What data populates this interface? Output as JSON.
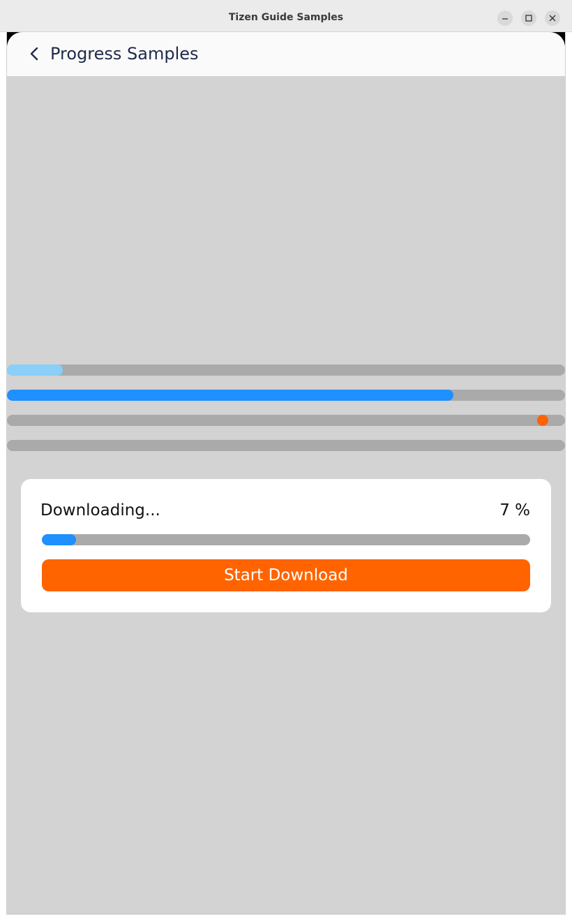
{
  "window": {
    "title": "Tizen Guide Samples",
    "controls": {
      "minimize_icon": "minimize-icon",
      "maximize_icon": "maximize-icon",
      "close_icon": "close-icon"
    }
  },
  "appbar": {
    "back_icon": "chevron-left-icon",
    "title": "Progress Samples"
  },
  "progress_bars": [
    {
      "style": "buffer",
      "value": 0.1,
      "color": "#89cff7"
    },
    {
      "style": "determinate",
      "value": 0.8,
      "color": "#1e90ff"
    },
    {
      "style": "indeterminate",
      "indicator_position": 0.96,
      "color": "#ff6200"
    },
    {
      "style": "empty",
      "value": 0.0
    }
  ],
  "download_card": {
    "label": "Downloading...",
    "percent_text": "7 %",
    "progress": 0.07,
    "button_label": "Start Download"
  },
  "colors": {
    "accent_blue": "#1e90ff",
    "accent_orange": "#ff6400",
    "track": "#aaaaaa",
    "background": "#d3d3d3",
    "title_text": "#1f2a4b"
  }
}
